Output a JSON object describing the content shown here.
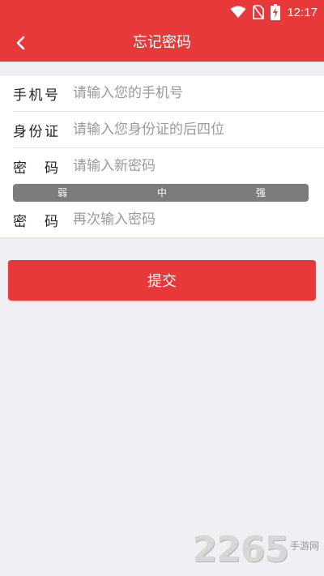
{
  "status_bar": {
    "time": "12:17",
    "icons": [
      "wifi-icon",
      "no-sim-icon",
      "battery-charging-icon"
    ]
  },
  "nav": {
    "back_icon": "chevron-left-icon",
    "title": "忘记密码"
  },
  "form": {
    "phone": {
      "label": "手机号",
      "placeholder": "请输入您的手机号",
      "value": ""
    },
    "id_card": {
      "label": "身份证",
      "placeholder": "请输入您身份证的后四位",
      "value": ""
    },
    "new_password": {
      "label": "密 码",
      "placeholder": "请输入新密码",
      "value": ""
    },
    "strength": {
      "weak": "弱",
      "medium": "中",
      "strong": "强"
    },
    "confirm_password": {
      "label": "密 码",
      "placeholder": "再次输入密码",
      "value": ""
    }
  },
  "submit_label": "提交",
  "watermark": {
    "number": "2265",
    "text": "手游网"
  },
  "colors": {
    "primary": "#e8393a",
    "background": "#efeff4",
    "strength_bar": "#7c7c7c",
    "placeholder": "#9a9a9a"
  }
}
